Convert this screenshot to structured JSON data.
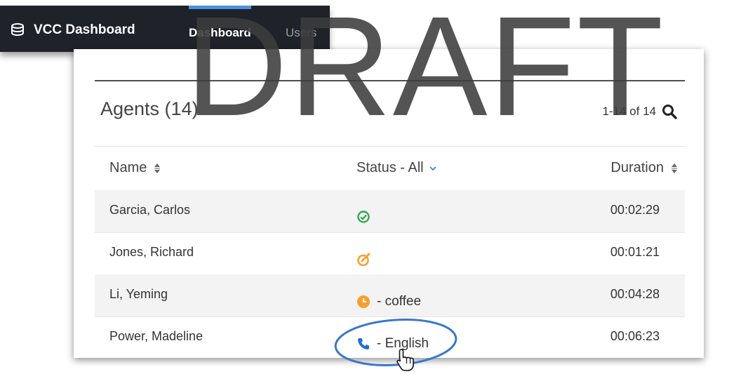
{
  "navbar": {
    "brand": "VCC Dashboard",
    "tabs": [
      {
        "label": "Dashboard",
        "active": true
      },
      {
        "label": "Users",
        "active": false
      }
    ]
  },
  "panel": {
    "title": "Agents (14)",
    "pager": "1-14 of 14",
    "columns": {
      "name": "Name",
      "status": "Status - All",
      "duration": "Duration"
    }
  },
  "agents": [
    {
      "name": "Garcia, Carlos",
      "status_icon": "ready-check-icon",
      "status_text": "",
      "duration": "00:02:29"
    },
    {
      "name": "Jones, Richard",
      "status_icon": "after-call-work-icon",
      "status_text": "",
      "duration": "00:01:21"
    },
    {
      "name": "Li, Yeming",
      "status_icon": "not-ready-clock-icon",
      "status_text": "- coffee",
      "duration": "00:04:28"
    },
    {
      "name": "Power, Madeline",
      "status_icon": "on-call-phone-icon",
      "status_text": "- English",
      "duration": "00:06:23"
    }
  ],
  "colors": {
    "ready": "#2eaa4f",
    "acw": "#f5a030",
    "not_ready": "#f5a030",
    "on_call": "#1f6fd1",
    "accent": "#4a90e2"
  },
  "watermark": "DRAFT"
}
